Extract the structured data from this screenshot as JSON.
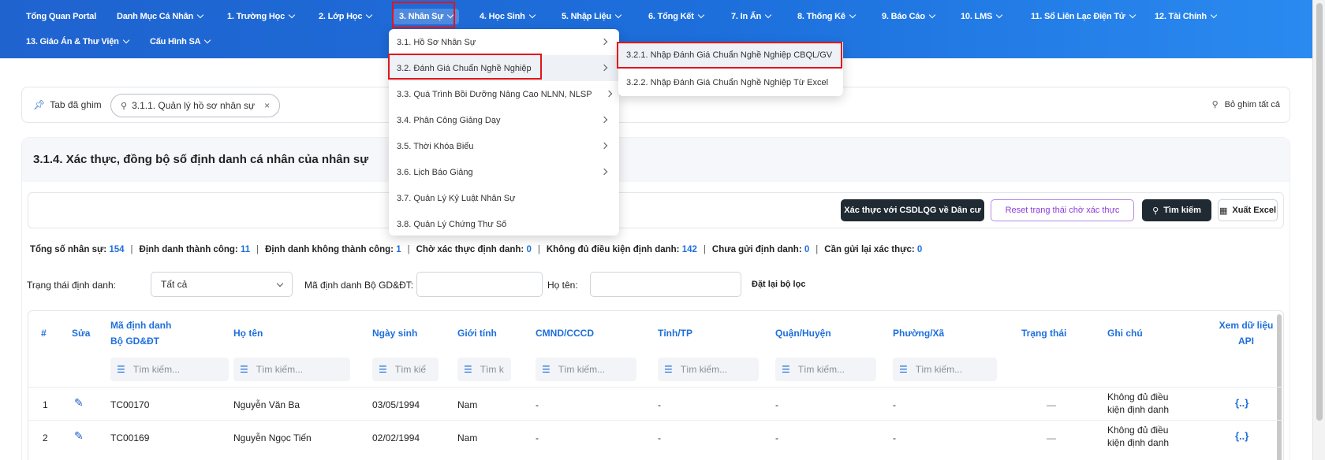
{
  "nav": {
    "items": [
      {
        "label": "Tổng Quan Portal",
        "chev": false
      },
      {
        "label": "Danh Mục Cá Nhân",
        "chev": true
      },
      {
        "label": "1. Trường Học",
        "chev": true
      },
      {
        "label": "2. Lớp Học",
        "chev": true
      },
      {
        "label": "3. Nhân Sự",
        "chev": true,
        "active": true
      },
      {
        "label": "4. Học Sinh",
        "chev": true
      },
      {
        "label": "5. Nhập Liệu",
        "chev": true
      },
      {
        "label": "6. Tổng Kết",
        "chev": true
      },
      {
        "label": "7. In Ấn",
        "chev": true
      },
      {
        "label": "8. Thống Kê",
        "chev": true
      },
      {
        "label": "9. Báo Cáo",
        "chev": true
      },
      {
        "label": "10. LMS",
        "chev": true
      },
      {
        "label": "11. Sổ Liên Lạc Điện Tử",
        "chev": true
      },
      {
        "label": "12. Tài Chính",
        "chev": true
      },
      {
        "label": "13. Giáo Án & Thư Viện",
        "chev": true
      },
      {
        "label": "Cấu Hình SA",
        "chev": true
      }
    ]
  },
  "menu": {
    "items": [
      {
        "label": "3.1. Hồ Sơ Nhân Sự",
        "has_sub": true
      },
      {
        "label": "3.2. Đánh Giá Chuẩn Nghề Nghiệp",
        "has_sub": true,
        "highlighted": true
      },
      {
        "label": "3.3. Quá Trình Bồi Dưỡng Nâng Cao NLNN, NLSP",
        "has_sub": true
      },
      {
        "label": "3.4. Phân Công Giảng Dạy",
        "has_sub": true
      },
      {
        "label": "3.5. Thời Khóa Biểu",
        "has_sub": true
      },
      {
        "label": "3.6. Lịch Báo Giảng",
        "has_sub": true
      },
      {
        "label": "3.7. Quản Lý Kỷ Luật Nhân Sự",
        "has_sub": false
      },
      {
        "label": "3.8. Quản Lý Chứng Thư Số",
        "has_sub": false
      }
    ],
    "submenu": [
      {
        "label": "3.2.1. Nhập Đánh Giá Chuẩn Nghề Nghiệp CBQL/GV",
        "highlighted": true
      },
      {
        "label": "3.2.2. Nhập Đánh Giá Chuẩn Nghề Nghiệp Từ Excel"
      }
    ]
  },
  "pinbar": {
    "label": "Tab đã ghim",
    "chip": "3.1.1. Quản lý hồ sơ nhân sự",
    "chip_close": "×",
    "unpin_all": "Bỏ ghim tất cả"
  },
  "page": {
    "title": "3.1.4. Xác thực, đồng bộ số định danh cá nhân của nhân sự"
  },
  "toolbar": {
    "verify": "Xác thực với CSDLQG về Dân cư",
    "reset": "Reset trạng thái chờ xác thực",
    "search": "Tìm kiếm",
    "export": "Xuất Excel"
  },
  "stats": [
    {
      "label": "Tổng số nhân sự:",
      "value": "154"
    },
    {
      "label": "Định danh thành công:",
      "value": "11"
    },
    {
      "label": "Định danh không thành công:",
      "value": "1"
    },
    {
      "label": "Chờ xác thực định danh:",
      "value": "0"
    },
    {
      "label": "Không đủ điều kiện định danh:",
      "value": "142"
    },
    {
      "label": "Chưa gửi định danh:",
      "value": "0"
    },
    {
      "label": "Cần gửi lại xác thực:",
      "value": "0"
    }
  ],
  "filters": {
    "status_label": "Trạng thái định danh:",
    "status_value": "Tất cả",
    "code_label": "Mã định danh Bộ GD&ĐT:",
    "name_label": "Họ tên:",
    "reset_label": "Đặt lại bộ lọc"
  },
  "table": {
    "headers": {
      "idx": "#",
      "edit": "Sửa",
      "code_1": "Mã định danh",
      "code_2": "Bộ GD&ĐT",
      "name": "Họ tên",
      "dob": "Ngày sinh",
      "gender": "Giới tính",
      "idcard": "CMND/CCCD",
      "province": "Tỉnh/TP",
      "district": "Quận/Huyện",
      "ward": "Phường/Xã",
      "status": "Trạng thái",
      "note": "Ghi chú",
      "api_1": "Xem dữ liệu",
      "api_2": "API"
    },
    "filter_placeholders": {
      "code": "Tìm kiếm...",
      "name": "Tìm kiếm...",
      "dob": "Tìm kiế",
      "gender": "Tìm k",
      "idcard": "Tìm kiếm...",
      "province": "Tìm kiếm...",
      "district": "Tìm kiếm...",
      "ward": "Tìm kiếm..."
    },
    "rows": [
      {
        "idx": "1",
        "code": "TC00170",
        "name": "Nguyễn Văn Ba",
        "dob": "03/05/1994",
        "gender": "Nam",
        "idcard": "-",
        "province": "-",
        "district": "-",
        "ward": "-",
        "status": "—",
        "note_1": "Không đủ điều",
        "note_2": "kiện định danh",
        "api": "{..}"
      },
      {
        "idx": "2",
        "code": "TC00169",
        "name": "Nguyễn Ngọc Tiến",
        "dob": "02/02/1994",
        "gender": "Nam",
        "idcard": "-",
        "province": "-",
        "district": "-",
        "ward": "-",
        "status": "—",
        "note_1": "Không đủ điều",
        "note_2": "kiện định danh",
        "api": "{..}"
      }
    ]
  }
}
